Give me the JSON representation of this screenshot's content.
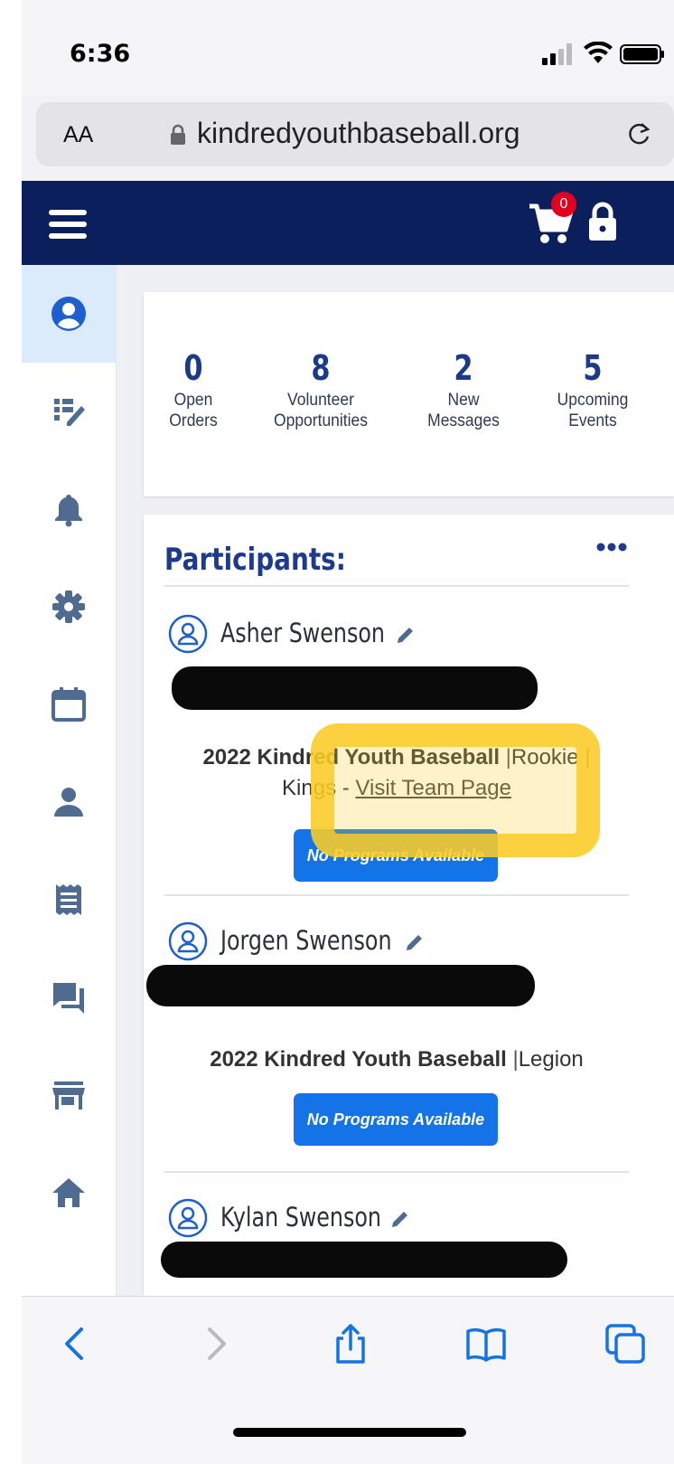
{
  "status_bar": {
    "time": "6:36"
  },
  "browser": {
    "text_size_label": "AA",
    "url": "kindredyouthbaseball.org"
  },
  "header": {
    "cart_count": "0"
  },
  "sidebar": {
    "items": [
      {
        "icon": "user-circle-icon",
        "active": true
      },
      {
        "icon": "checklist-edit-icon"
      },
      {
        "icon": "bell-icon"
      },
      {
        "icon": "gear-icon"
      },
      {
        "icon": "calendar-icon"
      },
      {
        "icon": "person-icon"
      },
      {
        "icon": "receipt-icon"
      },
      {
        "icon": "messages-icon"
      },
      {
        "icon": "store-icon"
      },
      {
        "icon": "home-icon"
      }
    ]
  },
  "stats": [
    {
      "num": "0",
      "label1": "Open",
      "label2": "Orders"
    },
    {
      "num": "8",
      "label1": "Volunteer",
      "label2": "Opportunities"
    },
    {
      "num": "2",
      "label1": "New",
      "label2": "Messages"
    },
    {
      "num": "5",
      "label1": "Upcoming",
      "label2": "Events"
    }
  ],
  "participants": {
    "title": "Participants:",
    "list": [
      {
        "name": "Asher Swenson",
        "program_org": "2022 Kindred Youth Baseball",
        "program_level": "Rookie",
        "program_team": "Kings -",
        "team_link": "Visit Team Page",
        "button": "No Programs Available"
      },
      {
        "name": "Jorgen Swenson",
        "program_org": "2022 Kindred Youth Baseball",
        "program_level": "Legion",
        "button": "No Programs Available"
      },
      {
        "name": "Kylan Swenson"
      }
    ]
  },
  "colors": {
    "header_bg": "#0b1f5c",
    "accent": "#1473e6",
    "badge": "#e1001e",
    "title": "#1d3a8f"
  }
}
